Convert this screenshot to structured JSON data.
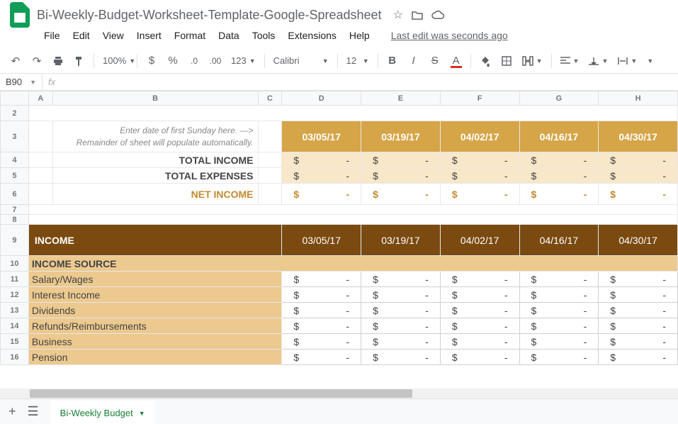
{
  "title": "Bi-Weekly-Budget-Worksheet-Template-Google-Spreadsheet",
  "menu": [
    "File",
    "Edit",
    "View",
    "Insert",
    "Format",
    "Data",
    "Tools",
    "Extensions",
    "Help"
  ],
  "last_edit": "Last edit was seconds ago",
  "toolbar": {
    "zoom": "100%",
    "font": "Calibri",
    "size": "12"
  },
  "cell_ref": "B90",
  "cols": [
    "A",
    "B",
    "C",
    "D",
    "E",
    "F",
    "G",
    "H"
  ],
  "rows": [
    "2",
    "3",
    "4",
    "5",
    "6",
    "7",
    "8",
    "9",
    "10",
    "11",
    "12",
    "13",
    "14",
    "15",
    "16"
  ],
  "dates": [
    "03/05/17",
    "03/19/17",
    "04/02/17",
    "04/16/17",
    "04/30/17"
  ],
  "hint_line1": "Enter date of first Sunday here. —>",
  "hint_line2": "Remainder of sheet will populate automatically.",
  "total_income_lbl": "TOTAL INCOME",
  "total_expenses_lbl": "TOTAL EXPENSES",
  "net_income_lbl": "NET INCOME",
  "section_income": "INCOME",
  "section_source": "INCOME SOURCE",
  "income_rows": [
    "Salary/Wages",
    "Interest Income",
    "Dividends",
    "Refunds/Reimbursements",
    "Business",
    "Pension"
  ],
  "dollar": "$",
  "dash": "-",
  "sheet_tab": "Bi-Weekly Budget"
}
